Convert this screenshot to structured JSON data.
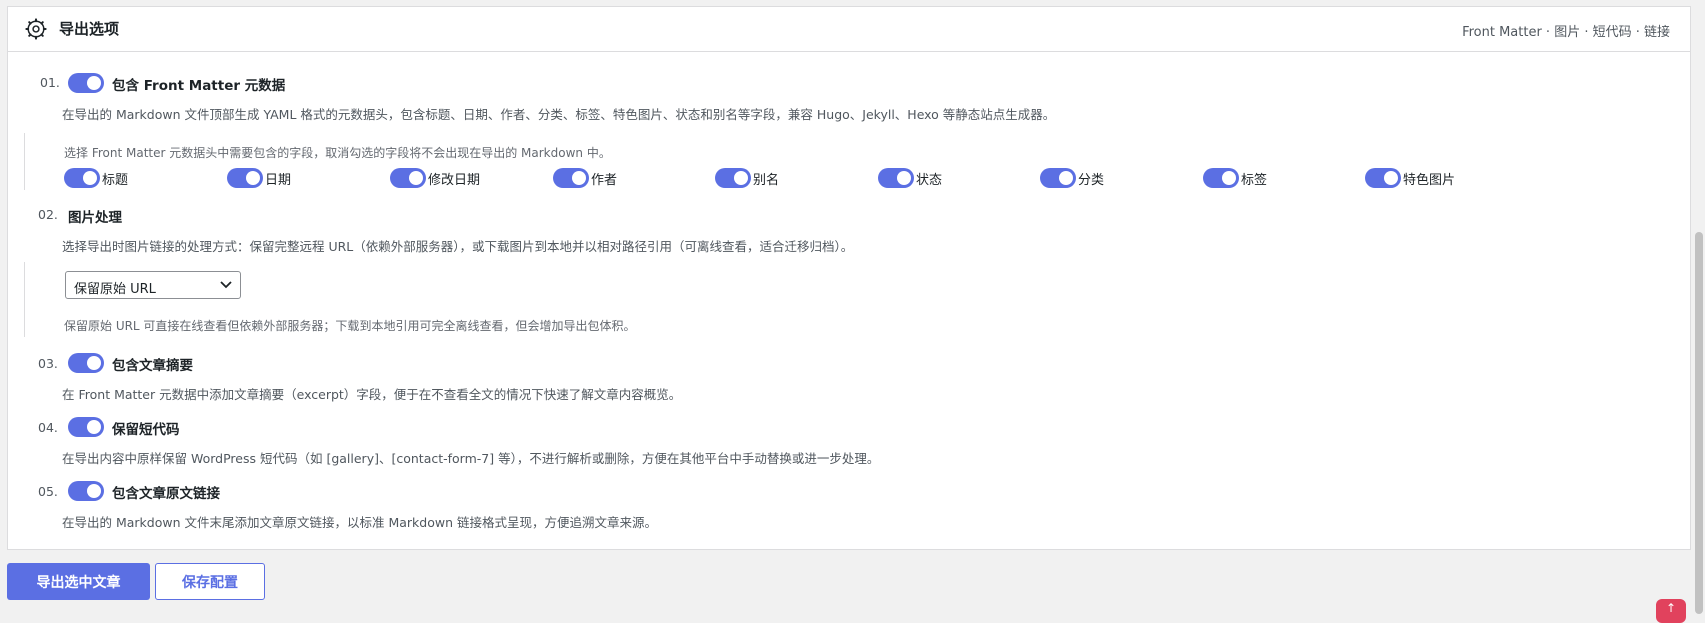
{
  "header": {
    "title": "导出选项",
    "right_text": "Front Matter · 图片 · 短代码 · 链接"
  },
  "options": [
    {
      "num": "01.",
      "label": "包含 Front Matter 元数据",
      "enabled": true,
      "desc": "在导出的 Markdown 文件顶部生成 YAML 格式的元数据头，包含标题、日期、作者、分类、标签、特色图片、状态和别名等字段，兼容 Hugo、Jekyll、Hexo 等静态站点生成器。"
    },
    {
      "num": "02.",
      "label": "图片处理",
      "desc": "选择导出时图片链接的处理方式：保留完整远程 URL（依赖外部服务器），或下载图片到本地并以相对路径引用（可离线查看，适合迁移归档）。"
    },
    {
      "num": "03.",
      "label": "包含文章摘要",
      "enabled": true,
      "desc": "在 Front Matter 元数据中添加文章摘要（excerpt）字段，便于在不查看全文的情况下快速了解文章内容概览。"
    },
    {
      "num": "04.",
      "label": "保留短代码",
      "enabled": true,
      "desc": "在导出内容中原样保留 WordPress 短代码（如 [gallery]、[contact-form-7] 等），不进行解析或删除，方便在其他平台中手动替换或进一步处理。"
    },
    {
      "num": "05.",
      "label": "包含文章原文链接",
      "enabled": true,
      "desc": "在导出的 Markdown 文件末尾添加文章原文链接，以标准 Markdown 链接格式呈现，方便追溯文章来源。"
    }
  ],
  "front_matter_fields": {
    "note": "选择 Front Matter 元数据头中需要包含的字段，取消勾选的字段将不会出现在导出的 Markdown 中。",
    "fields": [
      "标题",
      "日期",
      "修改日期",
      "作者",
      "别名",
      "状态",
      "分类",
      "标签",
      "特色图片"
    ]
  },
  "image_select": {
    "value": "保留原始 URL",
    "note": "保留原始 URL 可直接在线查看但依赖外部服务器；下载到本地引用可完全离线查看，但会增加导出包体积。"
  },
  "buttons": {
    "export": "导出选中文章",
    "save": "保存配置"
  },
  "back_to_top": "↑",
  "colors": {
    "accent": "#5b6fe3",
    "back_to_top": "#e1425d"
  }
}
